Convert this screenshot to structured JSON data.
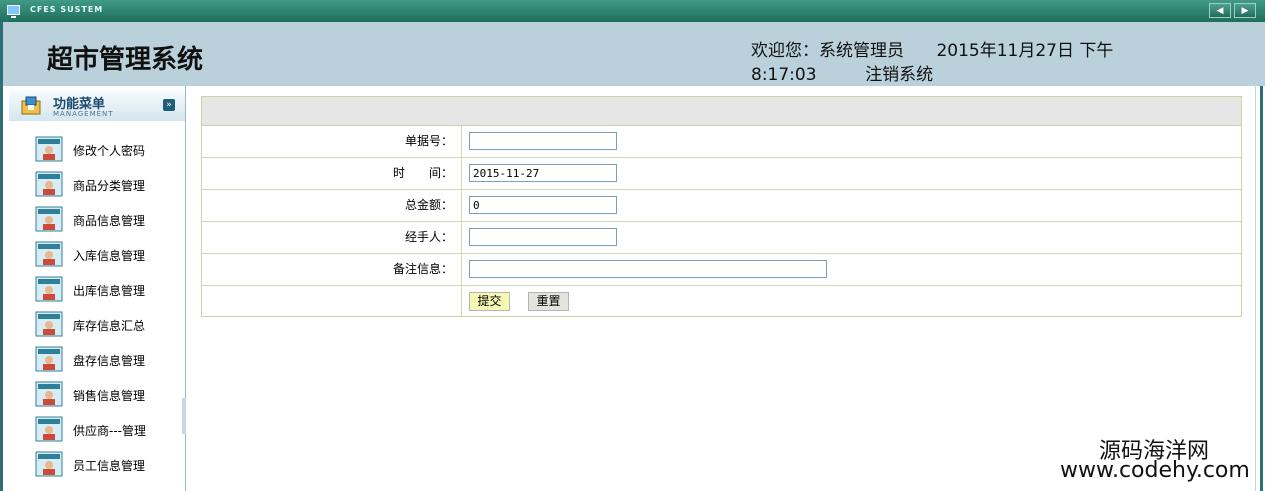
{
  "window": {
    "title": "CFES SUSTEM"
  },
  "header": {
    "app_title": "超市管理系统",
    "welcome": "欢迎您：系统管理员",
    "datetime_date": "2015年11月27日 下午",
    "datetime_time": "8:17:03",
    "logout": "注销系统"
  },
  "sidebar": {
    "title": "功能菜单",
    "subtitle": "MANAGEMENT",
    "items": [
      {
        "label": "修改个人密码"
      },
      {
        "label": "商品分类管理"
      },
      {
        "label": "商品信息管理"
      },
      {
        "label": "入库信息管理"
      },
      {
        "label": "出库信息管理"
      },
      {
        "label": "库存信息汇总"
      },
      {
        "label": "盘存信息管理"
      },
      {
        "label": "销售信息管理"
      },
      {
        "label": "供应商---管理"
      },
      {
        "label": "员工信息管理"
      }
    ]
  },
  "form": {
    "fields": [
      {
        "label": "单据号：",
        "value": ""
      },
      {
        "label": "时　　间：",
        "value": "2015-11-27"
      },
      {
        "label": "总金额：",
        "value": "0"
      },
      {
        "label": "经手人：",
        "value": ""
      },
      {
        "label": "备注信息：",
        "value": ""
      }
    ],
    "submit_label": "提交",
    "reset_label": "重置"
  },
  "watermark": {
    "line1": "源码海洋网",
    "line2": "www.codehy.com"
  },
  "colors": {
    "header_bg": "#bad1db",
    "topbar": "#2a7d6b",
    "accent": "#2d6f73"
  },
  "icons": [
    "monitor-icon",
    "prev-arrow-icon",
    "next-arrow-icon",
    "menu-folder-icon",
    "collapse-icon",
    "user-card-icon"
  ]
}
